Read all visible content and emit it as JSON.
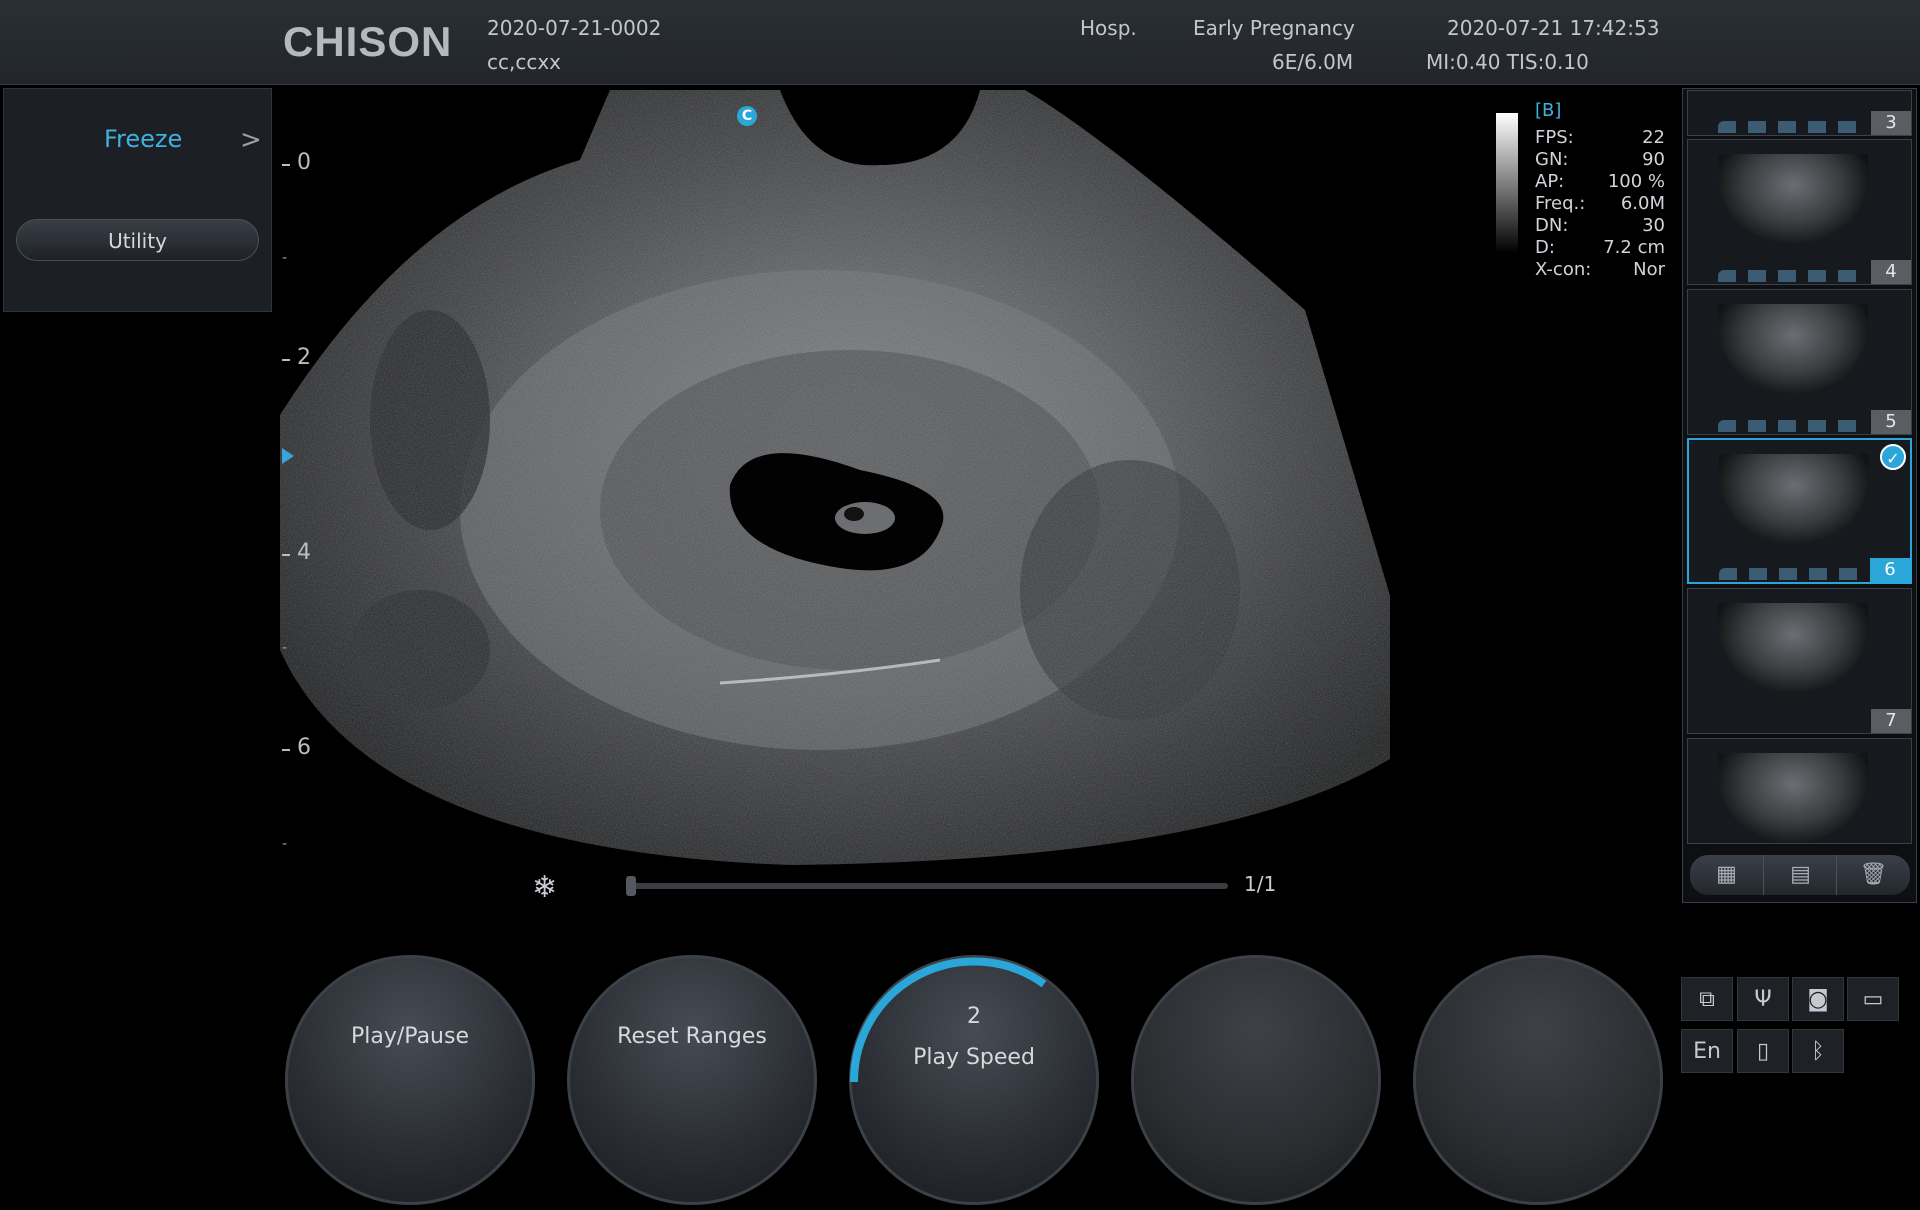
{
  "header": {
    "brand": "CHISON",
    "patient_id": "2020-07-21-0002",
    "patient_name": "cc,ccxx",
    "hospital": "Hosp.",
    "exam_preset": "Early Pregnancy",
    "probe_freq": "6E/6.0M",
    "datetime": "2020-07-21 17:42:53",
    "mi_tis": "MI:0.40  TIS:0.10"
  },
  "left_menu": {
    "freeze_label": "Freeze",
    "freeze_arrow": ">",
    "utility_label": "Utility"
  },
  "image": {
    "orientation_marker": "C",
    "depth_labels": [
      "0",
      "2",
      "4",
      "6"
    ],
    "depth_minor_marks": [
      "-",
      "-",
      "-",
      "-"
    ],
    "focus_marker_color": "#3aa3d8"
  },
  "params": {
    "mode": "[B]",
    "rows": [
      {
        "key": "FPS:",
        "value": "22"
      },
      {
        "key": "GN:",
        "value": "90"
      },
      {
        "key": "AP:",
        "value": "100 %"
      },
      {
        "key": "Freq.:",
        "value": "6.0M"
      },
      {
        "key": "DN:",
        "value": "30"
      },
      {
        "key": "D:",
        "value": "7.2 cm"
      },
      {
        "key": "X-con:",
        "value": "Nor"
      }
    ]
  },
  "cine": {
    "freeze_icon": "snowflake-icon",
    "frame_counter": "1/1",
    "position": 0.0
  },
  "thumbnails": {
    "items": [
      {
        "number": "3",
        "selected": false
      },
      {
        "number": "4",
        "selected": false
      },
      {
        "number": "5",
        "selected": false
      },
      {
        "number": "6",
        "selected": true
      },
      {
        "number": "7",
        "selected": false
      },
      {
        "number": "",
        "selected": false
      }
    ],
    "buttons": [
      "select-all-icon",
      "report-icon",
      "trash-icon"
    ]
  },
  "soft_keys": [
    {
      "label": "Play/Pause",
      "value": ""
    },
    {
      "label": "Reset Ranges",
      "value": ""
    },
    {
      "label": "Play Speed",
      "value": "2"
    },
    {
      "label": "",
      "value": ""
    },
    {
      "label": "",
      "value": ""
    }
  ],
  "status_icons": {
    "network": "network-icon",
    "usb": "usb-icon",
    "storage": "storage-icon",
    "printer": "printer-icon",
    "language": "En",
    "battery": "battery-icon",
    "bluetooth": "bluetooth-icon"
  },
  "accent_color": "#2aa7d8"
}
